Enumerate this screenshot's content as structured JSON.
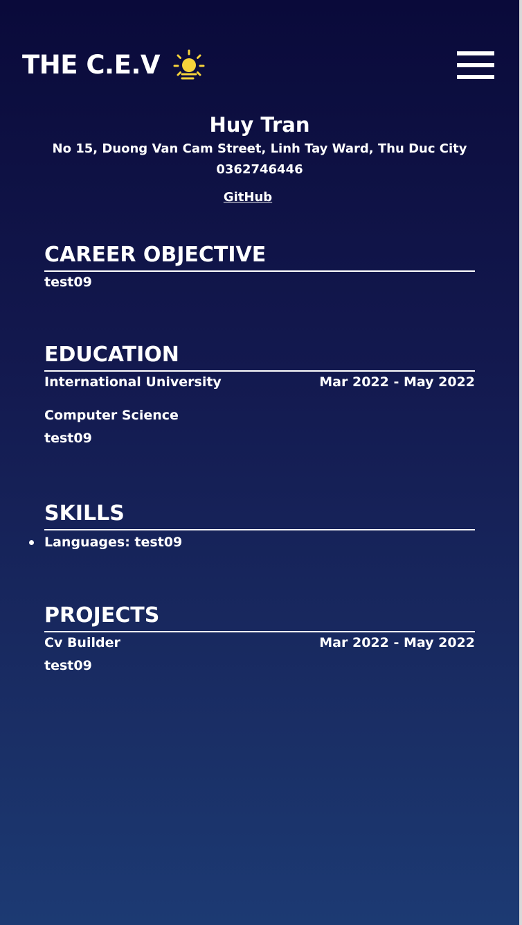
{
  "header": {
    "logo_text": "THE C.E.V",
    "logo_icon": "sun-icon",
    "menu_icon": "hamburger-menu-icon",
    "icon_color": "#f6d33a"
  },
  "profile": {
    "name": "Huy Tran",
    "address": "No 15, Duong Van Cam Street, Linh Tay Ward, Thu Duc City",
    "phone": "0362746446",
    "github_label": "GitHub"
  },
  "career_objective": {
    "title": "CAREER OBJECTIVE",
    "text": "test09"
  },
  "education": {
    "title": "EDUCATION",
    "school": "International University",
    "dates": "Mar 2022 - May 2022",
    "major": "Computer Science",
    "description": "test09"
  },
  "skills": {
    "title": "SKILLS",
    "items": [
      {
        "label": "Languages: test09"
      }
    ]
  },
  "projects": {
    "title": "PROJECTS",
    "items": [
      {
        "name": "Cv Builder",
        "dates": "Mar 2022 - May 2022",
        "description": "test09"
      }
    ]
  }
}
